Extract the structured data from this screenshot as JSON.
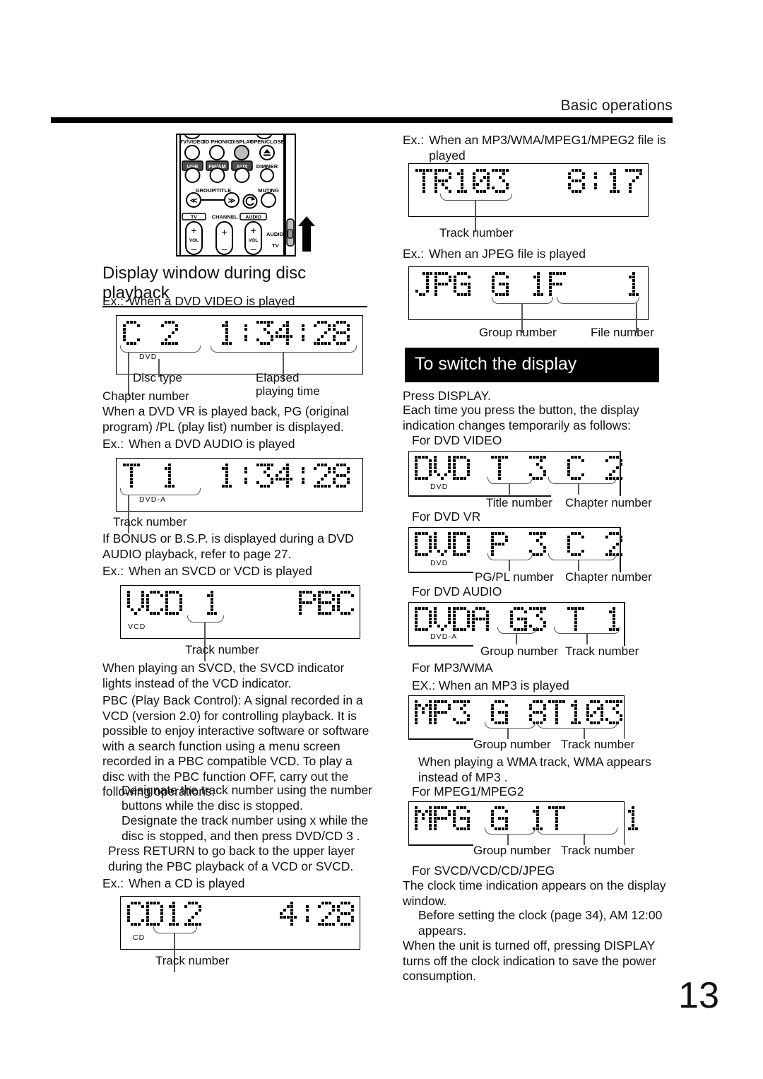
{
  "header": {
    "title": "Basic operations"
  },
  "page_number": "13",
  "remote": {
    "labels": {
      "tv_video": "TV/VIDEO",
      "phonic_3d": "3D PHONIC",
      "display": "DISPLAY",
      "open_close": "OPEN/CLOSE",
      "usb": "USB",
      "fm_am": "FM/AM",
      "aux": "AUX",
      "dimmer": "DIMMER",
      "group_title": "GROUP/TITLE",
      "muting": "MUTING",
      "tv": "TV",
      "channel": "CHANNEL",
      "audio": "AUDIO",
      "vol_left": "VOL",
      "vol_right": "VOL",
      "switch_audio": "AUDIO",
      "switch_tv": "TV"
    }
  },
  "left": {
    "section_title": "Display window during disc playback",
    "ex_dvd_video": {
      "lbl": "Ex.:",
      "text": "When a DVD VIDEO is played"
    },
    "disp_dvd_video": {
      "text": "C 2  1:34:28",
      "indicator": "DVD"
    },
    "callouts_dvd_video": {
      "chapter": "Chapter number",
      "disc_type": "Disc type",
      "elapsed_1": "Elapsed",
      "elapsed_2": "playing time"
    },
    "note_dvd_vr": "When a DVD VR is played back, PG (original program) /PL (play list) number is displayed.",
    "ex_dvd_audio": {
      "lbl": "Ex.:",
      "text": "When a DVD AUDIO is played"
    },
    "disp_dvd_audio": {
      "text": "T 1  1:34:28",
      "indicator": "DVD-A"
    },
    "callout_dvd_audio": {
      "track": "Track number"
    },
    "note_bonus": "If  BONUS  or  B.S.P.  is displayed during a DVD AUDIO playback, refer to page 27.",
    "ex_svcd": {
      "lbl": "Ex.:",
      "text": "When an SVCD or VCD is played"
    },
    "disp_vcd": {
      "text": "VCD 1    PBC",
      "indicator": "VCD"
    },
    "callout_vcd": {
      "track": "Track number"
    },
    "note_svcd": "When playing an SVCD, the SVCD indicator lights instead of the VCD indicator.",
    "note_pbc": "PBC (Play Back Control): A signal recorded in a VCD (version 2.0) for controlling playback. It is possible to enjoy interactive software or software with a search function using a menu screen recorded in a PBC compatible VCD. To play a disc with the PBC function OFF, carry out the following operations.",
    "pbc_step_1": "Designate the track number using the number buttons while the disc is stopped.",
    "pbc_step_2": "Designate the track number using x      while the disc is stopped, and then press DVD/CD 3  .",
    "note_return": "Press RETURN to go back to the upper layer during the PBC playback of a VCD or SVCD.",
    "ex_cd": {
      "lbl": "Ex.:",
      "text": "When a CD is played"
    },
    "disp_cd": {
      "text": "CD12    4:28",
      "indicator": "CD"
    },
    "callout_cd": {
      "track": "Track number"
    }
  },
  "right": {
    "ex_mp3": {
      "lbl": "Ex.:",
      "text_line1": "When an MP3/WMA/MPEG1/MPEG2 file is",
      "text_line2": "played"
    },
    "disp_tr": {
      "text": "TR103   8:17",
      "indicator": ""
    },
    "callout_tr": {
      "track": "Track number"
    },
    "ex_jpeg": {
      "lbl": "Ex.:",
      "text": "When an JPEG file is played"
    },
    "disp_jpg": {
      "text": "JPG G 1F   1",
      "indicator": ""
    },
    "callouts_jpg": {
      "group": "Group number",
      "file": "File number"
    },
    "section_title": "To switch the display",
    "intro_1": "Press DISPLAY.",
    "intro_2": "Each time you press the button, the display indication changes temporarily as follows:",
    "for_dvd_video": "For DVD VIDEO",
    "disp_dvd_video_sw": {
      "text": "DVD T 3 C 2",
      "indicator": "DVD"
    },
    "callouts_dvd_video_sw": {
      "title": "Title number",
      "chapter": "Chapter number"
    },
    "for_dvd_vr": "For DVD VR",
    "disp_dvd_vr_sw": {
      "text": "DVD P 3 C 2",
      "indicator": "DVD"
    },
    "callouts_dvd_vr_sw": {
      "pgpl": "PG/PL number",
      "chapter": "Chapter number"
    },
    "for_dvd_audio": "For DVD AUDIO",
    "disp_dvda_sw": {
      "text": "DVDA G3 T 1",
      "indicator": "DVD-A"
    },
    "callouts_dvda_sw": {
      "group": "Group number",
      "track": "Track number"
    },
    "for_mp3_wma": "For MP3/WMA",
    "ex_mp3_played": "EX.: When an MP3 is played",
    "disp_mp3_sw": {
      "text": "MP3 G 8T103",
      "indicator": ""
    },
    "callouts_mp3_sw": {
      "group": "Group number",
      "track": "Track number"
    },
    "note_wma": "When playing a WMA track,  WMA  appears instead of  MP3 .",
    "for_mpeg": "For MPEG1/MPEG2",
    "disp_mpg_sw": {
      "text": "MPG G 1T   1",
      "indicator": ""
    },
    "callouts_mpg_sw": {
      "group": "Group number",
      "track": "Track number"
    },
    "for_svcd": "For SVCD/VCD/CD/JPEG",
    "note_clock": "The clock time indication appears on the display window.",
    "note_before_clock": "Before setting the clock (page 34),  AM 12:00 appears.",
    "note_unit_off": "When the unit is turned off, pressing DISPLAY turns off the clock indication to save the power consumption."
  }
}
